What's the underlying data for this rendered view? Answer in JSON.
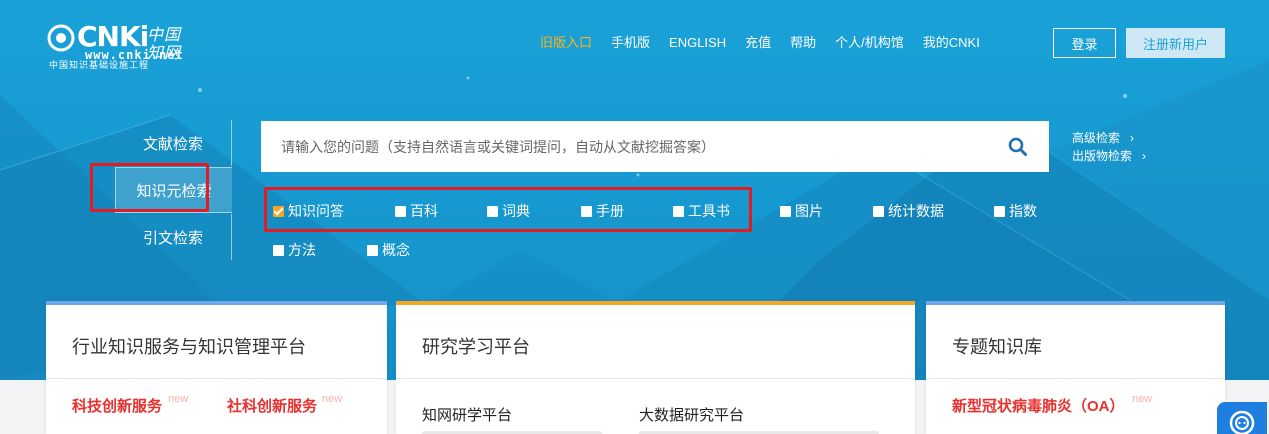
{
  "logo": {
    "letters": "CNKi",
    "cn": "中国知网",
    "url": "www.cnki.net",
    "tagline": "中国知识基础设施工程"
  },
  "topnav": {
    "items": [
      "旧版入口",
      "手机版",
      "ENGLISH",
      "充值",
      "帮助",
      "个人/机构馆",
      "我的CNKI"
    ],
    "highlight_color": "#ffb21c",
    "login": "登录",
    "register": "注册新用户"
  },
  "search": {
    "tabs": [
      "文献检索",
      "知识元检索",
      "引文检索"
    ],
    "active_tab": "知识元检索",
    "placeholder": "请输入您的问题（支持自然语言或关键词提问，自动从文献挖掘答案）",
    "advanced": "高级检索",
    "publication": "出版物检索",
    "options_row1": [
      "知识问答",
      "百科",
      "词典",
      "手册",
      "工具书",
      "图片",
      "统计数据",
      "指数"
    ],
    "options_row2": [
      "方法",
      "概念"
    ],
    "checked_option": "知识问答"
  },
  "cards": [
    {
      "title": "行业知识服务与知识管理平台",
      "accent": "#6fa8e8",
      "links": [
        "科技创新服务",
        "社科创新服务"
      ],
      "new_tag": "new"
    },
    {
      "title": "研究学习平台",
      "accent": "#f5a623",
      "subs": [
        "知网研学平台",
        "大数据研究平台"
      ]
    },
    {
      "title": "专题知识库",
      "accent": "#6fa8e8",
      "links": [
        "新型冠状病毒肺炎（OA）"
      ],
      "new_tag": "new"
    }
  ],
  "colors": {
    "brand_blue": "#1aa2d8",
    "annotation_red": "#e31b23",
    "link_red": "#e8312f"
  }
}
